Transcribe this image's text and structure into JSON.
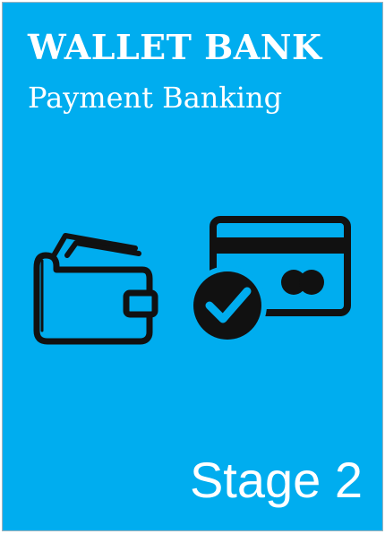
{
  "card": {
    "title": "WALLET BANK",
    "subtitle": "Payment Banking",
    "stage": "Stage 2"
  },
  "icons": {
    "left": "wallet-icon",
    "right": "credit-card-verified-icon"
  },
  "colors": {
    "background": "#00ADEF",
    "text": "#FFFFFF",
    "icon": "#111111"
  }
}
